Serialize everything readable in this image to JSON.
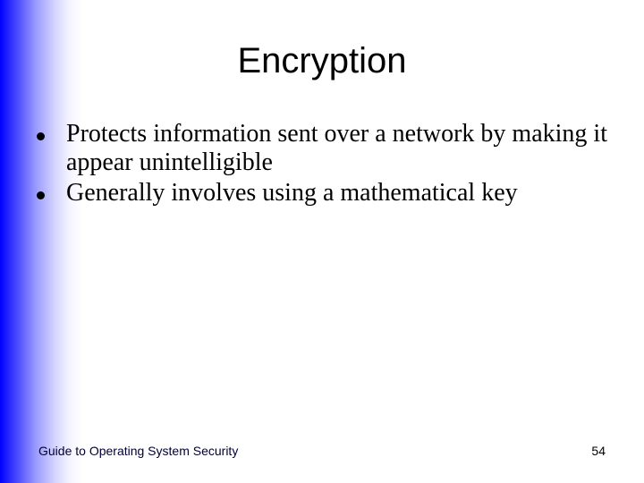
{
  "slide": {
    "title": "Encryption",
    "bullets": [
      {
        "text": "Protects information sent over a network by making it appear unintelligible"
      },
      {
        "text": "Generally involves using a mathematical key"
      }
    ],
    "footer": {
      "left": "Guide to Operating System Security",
      "page_number": "54"
    },
    "colors": {
      "gradient_start": "#0000ff",
      "gradient_end": "#ffffff",
      "text": "#000000"
    }
  }
}
